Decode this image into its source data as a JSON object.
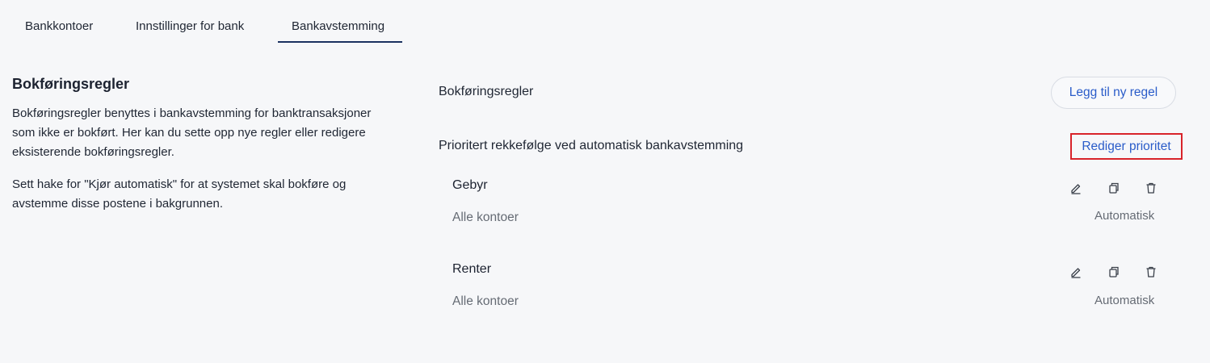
{
  "tabs": [
    {
      "label": "Bankkontoer"
    },
    {
      "label": "Innstillinger for bank"
    },
    {
      "label": "Bankavstemming",
      "active": true
    }
  ],
  "left": {
    "title": "Bokføringsregler",
    "paragraph1": "Bokføringsregler benyttes i bankavstemming for banktransaksjoner som ikke er bokført. Her kan du sette opp nye regler eller redigere eksisterende bokføringsregler.",
    "paragraph2": "Sett hake for \"Kjør automatisk\" for at systemet skal bokføre og avstemme disse postene i bakgrunnen."
  },
  "right": {
    "title": "Bokføringsregler",
    "add_rule_label": "Legg til ny regel",
    "priority_heading": "Prioritert rekkefølge ved automatisk bankavstemming",
    "edit_priority_label": "Rediger prioritet",
    "rules": [
      {
        "name": "Gebyr",
        "accounts": "Alle kontoer",
        "mode": "Automatisk"
      },
      {
        "name": "Renter",
        "accounts": "Alle kontoer",
        "mode": "Automatisk"
      }
    ]
  },
  "icons": {
    "edit": "pencil-icon",
    "copy": "copy-icon",
    "delete": "trash-icon"
  },
  "colors": {
    "background": "#f6f7f9",
    "link": "#2a5cc9",
    "active_tab_underline": "#1b3160",
    "highlight_border": "#d8232a"
  }
}
